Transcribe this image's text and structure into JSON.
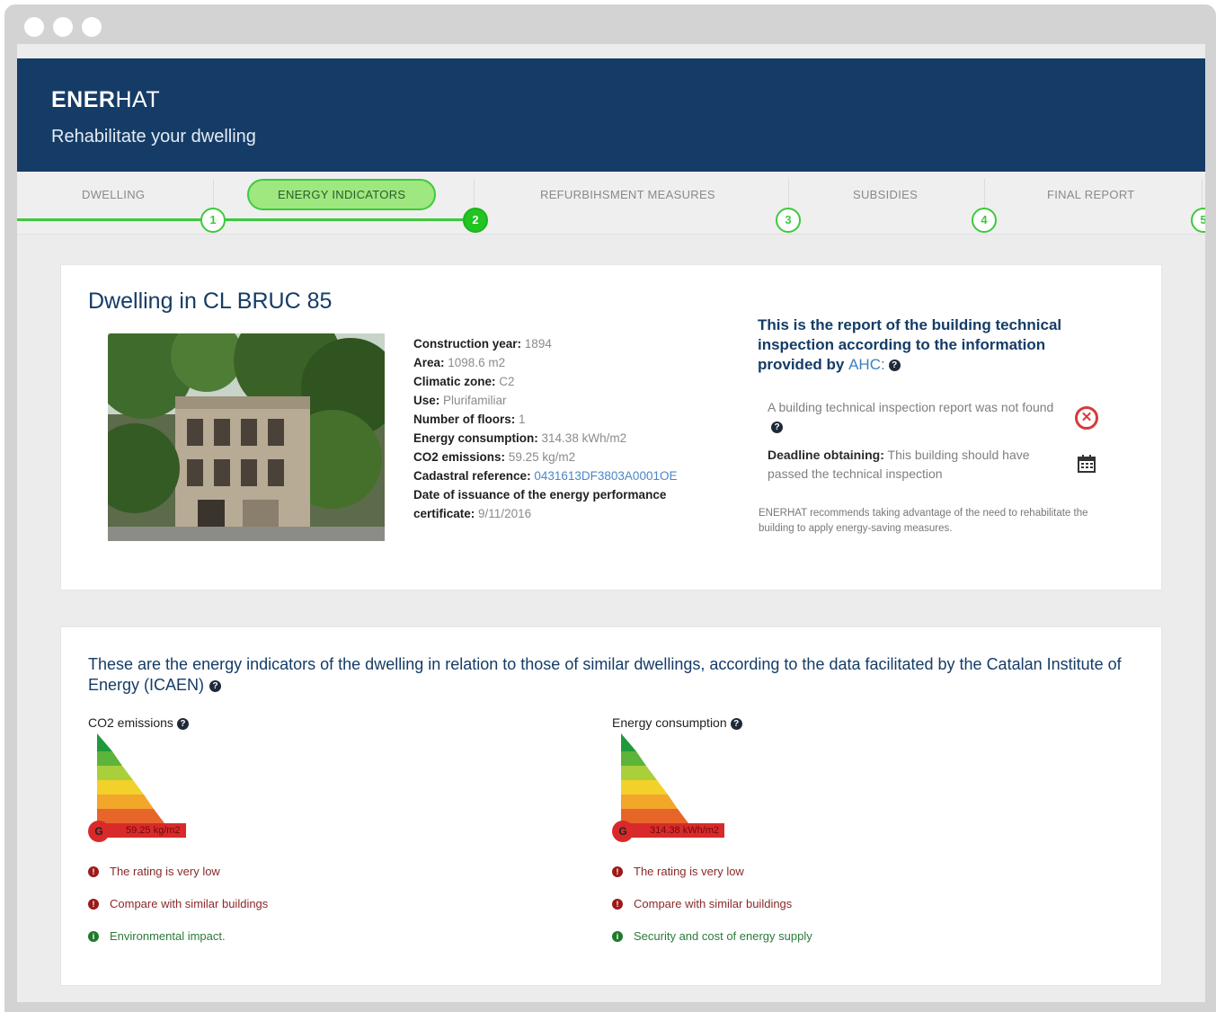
{
  "app": {
    "brand_bold": "ENER",
    "brand_light": "HAT",
    "tagline": "Rehabilitate your dwelling"
  },
  "steps": [
    {
      "label": "DWELLING",
      "number": "1"
    },
    {
      "label": "ENERGY INDICATORS",
      "number": "2"
    },
    {
      "label": "REFURBIHSMENT MEASURES",
      "number": "3"
    },
    {
      "label": "SUBSIDIES",
      "number": "4"
    },
    {
      "label": "FINAL REPORT",
      "number": "5"
    }
  ],
  "dwelling": {
    "title": "Dwelling in CL BRUC 85",
    "specs": [
      {
        "label": "Construction year:",
        "value": "1894"
      },
      {
        "label": "Area:",
        "value": "1098.6 m2"
      },
      {
        "label": "Climatic zone:",
        "value": "C2"
      },
      {
        "label": "Use:",
        "value": "Plurifamiliar"
      },
      {
        "label": "Number of floors:",
        "value": "1"
      },
      {
        "label": "Energy consumption:",
        "value": "314.38 kWh/m2"
      },
      {
        "label": "CO2 emissions:",
        "value": "59.25 kg/m2"
      },
      {
        "label": "Cadastral reference:",
        "value": "0431613DF3803A0001OE"
      },
      {
        "label": "Date of issuance of the energy performance certificate:",
        "value": "9/11/2016"
      }
    ]
  },
  "inspection": {
    "title": "This is the report of the building technical inspection according to the information provided by",
    "ahc": "AHC:",
    "not_found": "A building technical inspection report was not found",
    "deadline_label": "Deadline obtaining:",
    "deadline_text": "This building should have passed the technical inspection",
    "recommend": "ENERHAT recommends taking advantage of the need to rehabilitate the building to apply energy-saving measures."
  },
  "indicators": {
    "title": "These are the energy indicators of the dwelling in relation to those of similar dwellings, according to the data facilitated by the Catalan Institute of Energy (ICAEN)",
    "co2": {
      "label": "CO2 emissions",
      "rating": "G",
      "value": "59.25 kg/m2",
      "messages": [
        "The rating is very low",
        "Compare with similar buildings",
        "Environmental impact."
      ]
    },
    "energy": {
      "label": "Energy consumption",
      "rating": "G",
      "value": "314.38 kWh/m2",
      "messages": [
        "The rating is very low",
        "Compare with similar buildings",
        "Security and cost of energy supply"
      ]
    }
  },
  "colors": {
    "header": "#153c67",
    "accent_green": "#3ec93e",
    "rating_bad": "#d82a2a"
  },
  "icons": {
    "help": "question-circle-icon",
    "not_found": "times-circle-icon",
    "deadline": "calendar-icon",
    "warning": "exclamation-circle-icon",
    "info": "info-circle-icon"
  }
}
